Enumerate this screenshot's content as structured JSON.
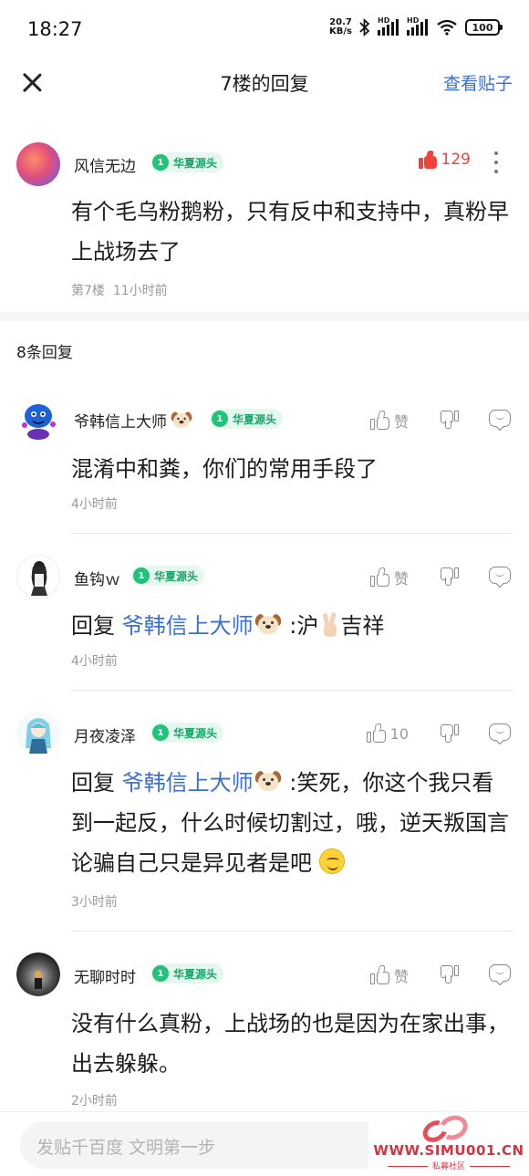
{
  "status_bar": {
    "time": "18:27",
    "net_speed_value": "20.7",
    "net_speed_unit": "KB/s",
    "signal_label": "HD",
    "battery": "100"
  },
  "nav": {
    "title": "7楼的回复",
    "view_post_label": "查看贴子"
  },
  "main_post": {
    "username": "风信无边",
    "badge_level": "1",
    "badge_label": "华夏源头",
    "like_count": "129",
    "text": "有个毛乌粉鹅粉，只有反中和支持中，真粉早上战场去了",
    "floor": "第7楼",
    "time": "11小时前"
  },
  "reply_count_label": "8条回复",
  "replies": [
    {
      "username": "爷韩信上大师",
      "badge_level": "1",
      "badge_label": "华夏源头",
      "like_label": "赞",
      "text": "混淆中和粪，你们的常用手段了",
      "time": "4小时前"
    },
    {
      "username": "鱼钩ｗ",
      "badge_level": "1",
      "badge_label": "华夏源头",
      "like_label": "赞",
      "reply_prefix": "回复",
      "reply_to": "爷韩信上大师",
      "text_before": " :沪",
      "text_after": "吉祥",
      "time": "4小时前"
    },
    {
      "username": "月夜凌泽",
      "badge_level": "1",
      "badge_label": "华夏源头",
      "like_label": "10",
      "reply_prefix": "回复",
      "reply_to": "爷韩信上大师",
      "text_before": " :笑死，你这个我只看到一起反，什么时候切割过，哦，逆天叛国言论骗自己只是异见者是吧",
      "time": "3小时前"
    },
    {
      "username": "无聊时时",
      "badge_level": "1",
      "badge_label": "华夏源头",
      "like_label": "赞",
      "text": "没有什么真粉，上战场的也是因为在家出事，出去躲躲。",
      "time": "2小时前"
    }
  ],
  "bottom": {
    "input_placeholder": "发贴千百度 文明第一步",
    "watermark_text": "WWW.SIMU001.CN",
    "watermark_sub": "私募社区"
  },
  "colors": {
    "link_blue": "#3a6fd8",
    "like_red": "#f0413d",
    "badge_green": "#22c27a",
    "watermark_red": "#d23442"
  },
  "icons": [
    "close-icon",
    "thumbs-up-icon",
    "thumbs-down-icon",
    "comment-icon",
    "more-icon",
    "dog-emoji-icon",
    "smile-emoji-icon",
    "victory-hand-emoji-icon",
    "bluetooth-icon",
    "wifi-icon",
    "signal-icon",
    "battery-icon"
  ]
}
